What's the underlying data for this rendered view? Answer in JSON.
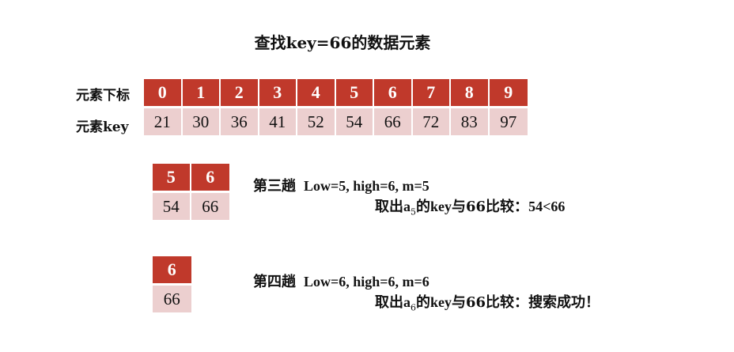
{
  "title": "查找key=66的数据元素",
  "labels": {
    "index_row": "元素下标",
    "key_row": "元素key"
  },
  "table": {
    "indices": [
      "0",
      "1",
      "2",
      "3",
      "4",
      "5",
      "6",
      "7",
      "8",
      "9"
    ],
    "keys": [
      "21",
      "30",
      "36",
      "41",
      "52",
      "54",
      "66",
      "72",
      "83",
      "97"
    ]
  },
  "steps": [
    {
      "indices": [
        "5",
        "6"
      ],
      "keys": [
        "54",
        "66"
      ],
      "name": "第三趟",
      "params": "Low=5, high=6, m=5",
      "take_prefix": "取出",
      "var": "a",
      "sub": "5",
      "middle": "的",
      "keyword": "key",
      "cmp_text": "与66比较：",
      "result": "54<66"
    },
    {
      "indices": [
        "6"
      ],
      "keys": [
        "66"
      ],
      "name": "第四趟",
      "params": "Low=6, high=6, m=6",
      "take_prefix": "取出",
      "var": "a",
      "sub": "6",
      "middle": "的",
      "keyword": "key",
      "cmp_text": "与66比较：",
      "result": "搜索成功！"
    }
  ],
  "colors": {
    "index_bg": "#c0392b",
    "key_bg": "#eccfcf"
  }
}
